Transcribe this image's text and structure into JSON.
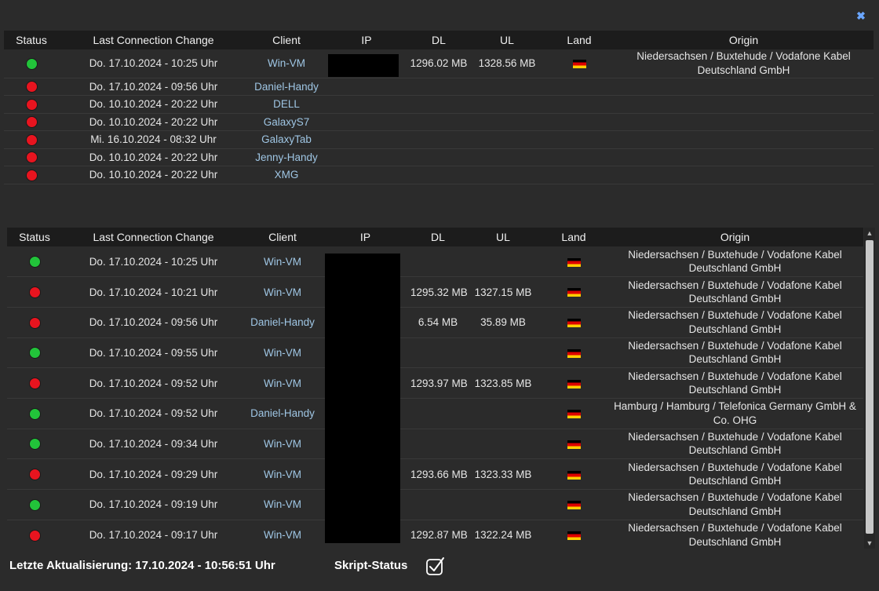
{
  "close_icon": "close-icon",
  "colors": {
    "online": "#22c33a",
    "offline": "#e8141f",
    "client_text": "#9fc6e4"
  },
  "headers": {
    "status": "Status",
    "last_change": "Last Connection Change",
    "client": "Client",
    "ip": "IP",
    "dl": "DL",
    "ul": "UL",
    "land": "Land",
    "origin": "Origin"
  },
  "current_connections": [
    {
      "status": "online",
      "time": "Do. 17.10.2024 - 10:25 Uhr",
      "client": "Win-VM",
      "dl": "1296.02 MB",
      "ul": "1328.56 MB",
      "flag": "de",
      "origin": "Niedersachsen / Buxtehude / Vodafone Kabel Deutschland GmbH"
    },
    {
      "status": "offline",
      "time": "Do. 17.10.2024 - 09:56 Uhr",
      "client": "Daniel-Handy",
      "dl": "",
      "ul": "",
      "flag": "",
      "origin": ""
    },
    {
      "status": "offline",
      "time": "Do. 10.10.2024 - 20:22 Uhr",
      "client": "DELL",
      "dl": "",
      "ul": "",
      "flag": "",
      "origin": ""
    },
    {
      "status": "offline",
      "time": "Do. 10.10.2024 - 20:22 Uhr",
      "client": "GalaxyS7",
      "dl": "",
      "ul": "",
      "flag": "",
      "origin": ""
    },
    {
      "status": "offline",
      "time": "Mi. 16.10.2024 - 08:32 Uhr",
      "client": "GalaxyTab",
      "dl": "",
      "ul": "",
      "flag": "",
      "origin": ""
    },
    {
      "status": "offline",
      "time": "Do. 10.10.2024 - 20:22 Uhr",
      "client": "Jenny-Handy",
      "dl": "",
      "ul": "",
      "flag": "",
      "origin": ""
    },
    {
      "status": "offline",
      "time": "Do. 10.10.2024 - 20:22 Uhr",
      "client": "XMG",
      "dl": "",
      "ul": "",
      "flag": "",
      "origin": ""
    }
  ],
  "history": [
    {
      "status": "online",
      "time": "Do. 17.10.2024 - 10:25 Uhr",
      "client": "Win-VM",
      "dl": "",
      "ul": "",
      "flag": "de",
      "origin": "Niedersachsen / Buxtehude / Vodafone Kabel Deutschland GmbH"
    },
    {
      "status": "offline",
      "time": "Do. 17.10.2024 - 10:21 Uhr",
      "client": "Win-VM",
      "dl": "1295.32 MB",
      "ul": "1327.15 MB",
      "flag": "de",
      "origin": "Niedersachsen / Buxtehude / Vodafone Kabel Deutschland GmbH"
    },
    {
      "status": "offline",
      "time": "Do. 17.10.2024 - 09:56 Uhr",
      "client": "Daniel-Handy",
      "dl": "6.54 MB",
      "ul": "35.89 MB",
      "flag": "de",
      "origin": "Niedersachsen / Buxtehude / Vodafone Kabel Deutschland GmbH"
    },
    {
      "status": "online",
      "time": "Do. 17.10.2024 - 09:55 Uhr",
      "client": "Win-VM",
      "dl": "",
      "ul": "",
      "flag": "de",
      "origin": "Niedersachsen / Buxtehude / Vodafone Kabel Deutschland GmbH"
    },
    {
      "status": "offline",
      "time": "Do. 17.10.2024 - 09:52 Uhr",
      "client": "Win-VM",
      "dl": "1293.97 MB",
      "ul": "1323.85 MB",
      "flag": "de",
      "origin": "Niedersachsen / Buxtehude / Vodafone Kabel Deutschland GmbH"
    },
    {
      "status": "online",
      "time": "Do. 17.10.2024 - 09:52 Uhr",
      "client": "Daniel-Handy",
      "dl": "",
      "ul": "",
      "flag": "de",
      "origin": "Hamburg / Hamburg / Telefonica Germany GmbH & Co. OHG"
    },
    {
      "status": "online",
      "time": "Do. 17.10.2024 - 09:34 Uhr",
      "client": "Win-VM",
      "dl": "",
      "ul": "",
      "flag": "de",
      "origin": "Niedersachsen / Buxtehude / Vodafone Kabel Deutschland GmbH"
    },
    {
      "status": "offline",
      "time": "Do. 17.10.2024 - 09:29 Uhr",
      "client": "Win-VM",
      "dl": "1293.66 MB",
      "ul": "1323.33 MB",
      "flag": "de",
      "origin": "Niedersachsen / Buxtehude / Vodafone Kabel Deutschland GmbH"
    },
    {
      "status": "online",
      "time": "Do. 17.10.2024 - 09:19 Uhr",
      "client": "Win-VM",
      "dl": "",
      "ul": "",
      "flag": "de",
      "origin": "Niedersachsen / Buxtehude / Vodafone Kabel Deutschland GmbH"
    },
    {
      "status": "offline",
      "time": "Do. 17.10.2024 - 09:17 Uhr",
      "client": "Win-VM",
      "dl": "1292.87 MB",
      "ul": "1322.24 MB",
      "flag": "de",
      "origin": "Niedersachsen / Buxtehude / Vodafone Kabel Deutschland GmbH"
    }
  ],
  "footer": {
    "last_update_label": "Letzte Aktualisierung: 17.10.2024 - 10:56:51 Uhr",
    "script_status_label": "Skript-Status",
    "script_status_checked": true
  }
}
